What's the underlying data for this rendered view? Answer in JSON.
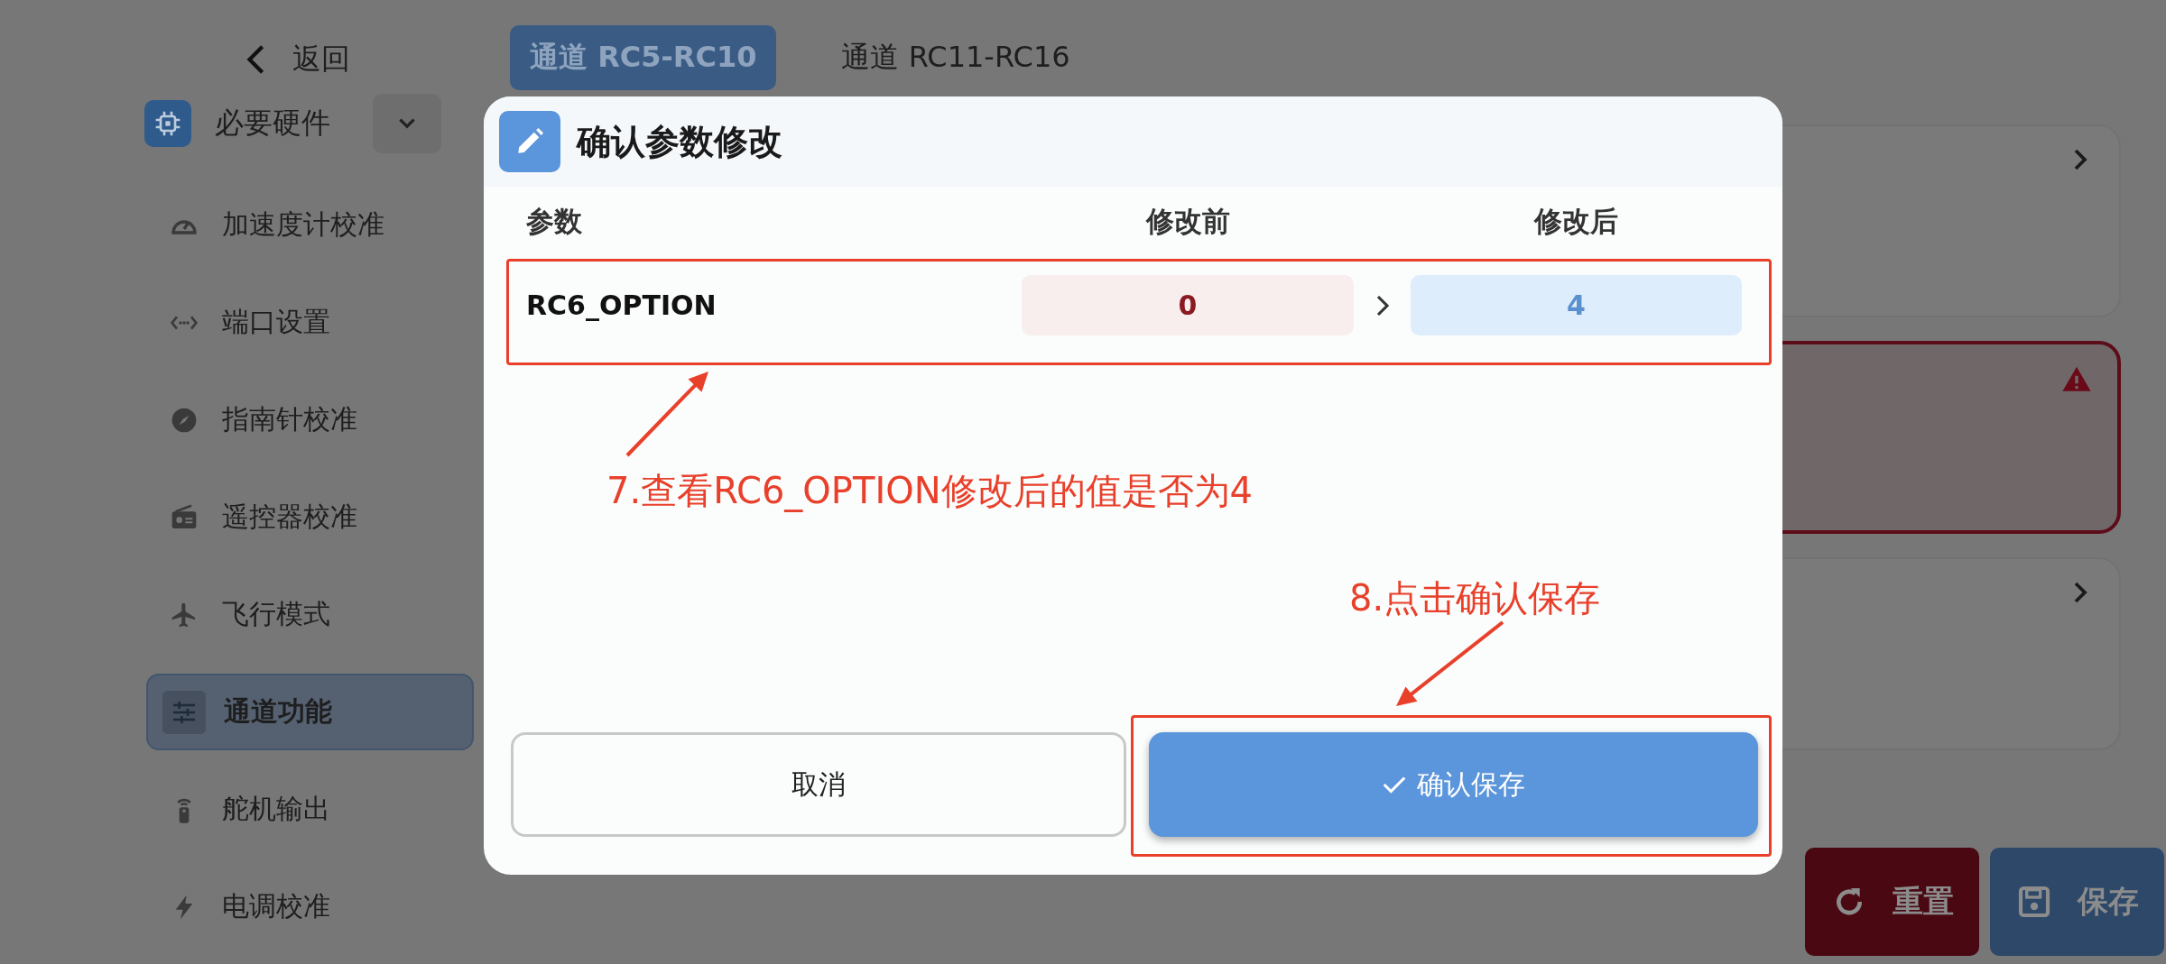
{
  "back": {
    "label": "返回"
  },
  "sidebar": {
    "group": {
      "label": "必要硬件",
      "expanded": true
    },
    "items": [
      {
        "label": "加速度计校准",
        "selected": false
      },
      {
        "label": "端口设置",
        "selected": false
      },
      {
        "label": "指南针校准",
        "selected": false
      },
      {
        "label": "遥控器校准",
        "selected": false
      },
      {
        "label": "飞行模式",
        "selected": false
      },
      {
        "label": "通道功能",
        "selected": true
      },
      {
        "label": "舵机输出",
        "selected": false
      },
      {
        "label": "电调校准",
        "selected": false
      }
    ]
  },
  "tabs": [
    {
      "label": "通道 RC5-RC10",
      "selected": true
    },
    {
      "label": "通道 RC11-RC16",
      "selected": false
    }
  ],
  "cards": [
    {
      "kind": "normal"
    },
    {
      "kind": "warning"
    },
    {
      "kind": "normal"
    }
  ],
  "footer_buttons": [
    {
      "label": "重置",
      "kind": "reset"
    },
    {
      "label": "保存",
      "kind": "save"
    }
  ],
  "dialog": {
    "title": "确认参数修改",
    "columns": [
      "参数",
      "修改前",
      "修改后"
    ],
    "rows": [
      {
        "name": "RC6_OPTION",
        "before": "0",
        "after": "4"
      }
    ],
    "buttons": [
      {
        "label": "取消",
        "kind": "secondary"
      },
      {
        "label": "确认保存",
        "kind": "primary"
      }
    ]
  },
  "annotations": [
    {
      "text": "7.查看RC6_OPTION修改后的值是否为4"
    },
    {
      "text": "8.点击确认保存"
    }
  ]
}
